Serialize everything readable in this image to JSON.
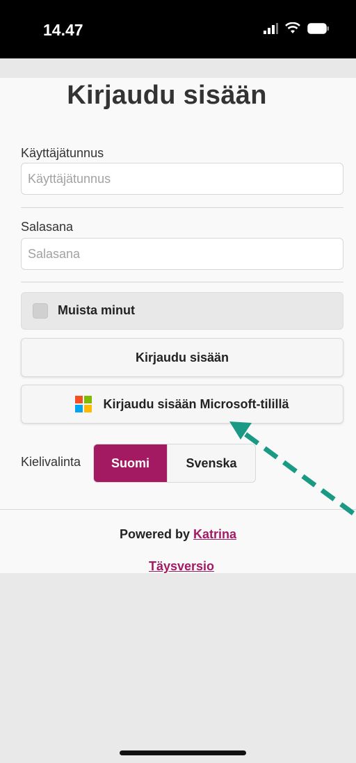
{
  "status_bar": {
    "time": "14.47",
    "icons": [
      "cellular-signal-icon",
      "wifi-icon",
      "battery-icon"
    ]
  },
  "login": {
    "title": "Kirjaudu sisään",
    "username": {
      "label": "Käyttäjätunnus",
      "placeholder": "Käyttäjätunnus",
      "value": ""
    },
    "password": {
      "label": "Salasana",
      "placeholder": "Salasana",
      "value": ""
    },
    "remember_me": {
      "label": "Muista minut",
      "checked": false
    },
    "login_button": "Kirjaudu sisään",
    "microsoft_button": "Kirjaudu sisään Microsoft-tilillä"
  },
  "language": {
    "label": "Kielivalinta",
    "options": [
      "Suomi",
      "Svenska"
    ],
    "selected": "Suomi"
  },
  "footer": {
    "powered_by": "Powered by",
    "katrina_link": "Katrina",
    "full_version_link": "Täysversio"
  },
  "colors": {
    "accent": "#a31a63",
    "annotation_arrow": "#1a9a84",
    "ms_red": "#f25022",
    "ms_green": "#7fba00",
    "ms_blue": "#00a4ef",
    "ms_yellow": "#ffb900"
  }
}
